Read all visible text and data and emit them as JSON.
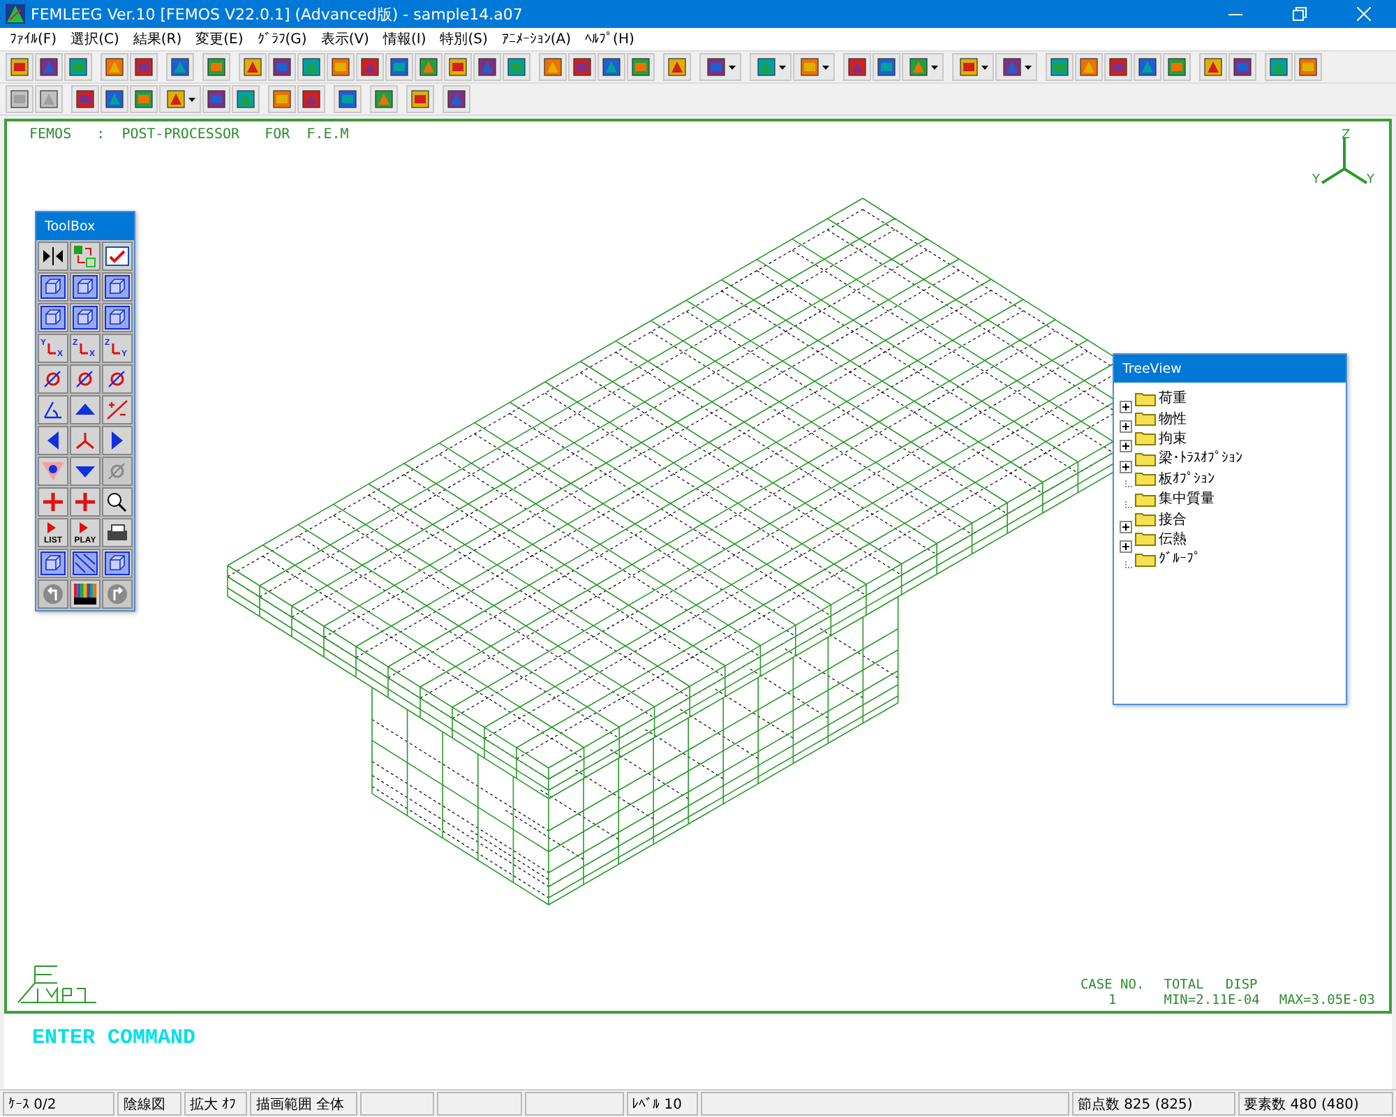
{
  "window": {
    "title": "FEMLEEG Ver.10 [FEMOS V22.0.1] (Advanced版) - sample14.a07"
  },
  "menu": [
    "ﾌｧｲﾙ(F)",
    "選択(C)",
    "結果(R)",
    "変更(E)",
    "ｸﾞﾗﾌ(G)",
    "表示(V)",
    "情報(I)",
    "特別(S)",
    "ｱﾆﾒｰｼｮﾝ(A)",
    "ﾍﾙﾌﾟ(H)"
  ],
  "canvas": {
    "header": "FEMOS   :  POST-PROCESSOR   FOR  F.E.M",
    "axes": [
      "Z",
      "Y",
      "Y"
    ],
    "result": {
      "case_label": "CASE NO.",
      "case_value": "1",
      "total_label": "TOTAL",
      "disp_label": "DISP",
      "min": "MIN=2.11E-04",
      "max": "MAX=3.05E-03"
    }
  },
  "toolbox": {
    "title": "ToolBox",
    "tools": [
      {
        "kind": "mirror",
        "disabled": false
      },
      {
        "kind": "swap",
        "disabled": false
      },
      {
        "kind": "check",
        "disabled": false
      },
      {
        "kind": "cube",
        "disabled": false
      },
      {
        "kind": "cube",
        "disabled": false
      },
      {
        "kind": "cube",
        "disabled": false
      },
      {
        "kind": "cube",
        "disabled": false
      },
      {
        "kind": "cube",
        "disabled": false
      },
      {
        "kind": "cube",
        "disabled": false
      },
      {
        "kind": "axis",
        "text": "Y",
        "text2": "X",
        "disabled": false
      },
      {
        "kind": "axis",
        "text": "Z",
        "text2": "X",
        "disabled": false
      },
      {
        "kind": "axis",
        "text": "Z",
        "text2": "Y",
        "disabled": false
      },
      {
        "kind": "rotate",
        "disabled": false
      },
      {
        "kind": "rotate",
        "disabled": false
      },
      {
        "kind": "rotate",
        "disabled": false
      },
      {
        "kind": "angle",
        "disabled": false
      },
      {
        "kind": "up",
        "disabled": false
      },
      {
        "kind": "plusminus",
        "disabled": false
      },
      {
        "kind": "left",
        "disabled": false
      },
      {
        "kind": "triad",
        "disabled": false
      },
      {
        "kind": "right",
        "disabled": false
      },
      {
        "kind": "eye",
        "disabled": false
      },
      {
        "kind": "down",
        "disabled": false
      },
      {
        "kind": "rotate",
        "disabled": true
      },
      {
        "kind": "move",
        "disabled": false
      },
      {
        "kind": "move",
        "disabled": false
      },
      {
        "kind": "zoom",
        "disabled": false
      },
      {
        "kind": "label",
        "text": "LIST",
        "disabled": false
      },
      {
        "kind": "label",
        "text": "PLAY",
        "disabled": false
      },
      {
        "kind": "printer",
        "disabled": false
      },
      {
        "kind": "cube",
        "disabled": false
      },
      {
        "kind": "hatch",
        "disabled": false
      },
      {
        "kind": "cube",
        "disabled": false
      },
      {
        "kind": "undo",
        "disabled": true
      },
      {
        "kind": "colors",
        "disabled": false
      },
      {
        "kind": "redo",
        "disabled": true
      }
    ]
  },
  "tree": {
    "title": "TreeView",
    "items": [
      {
        "label": "荷重",
        "has_children": true
      },
      {
        "label": "物性",
        "has_children": true
      },
      {
        "label": "拘束",
        "has_children": true
      },
      {
        "label": "梁･ﾄﾗｽｵﾌﾟｼｮﾝ",
        "has_children": true
      },
      {
        "label": "板ｵﾌﾟｼｮﾝ",
        "has_children": false
      },
      {
        "label": "集中質量",
        "has_children": false
      },
      {
        "label": "接合",
        "has_children": true
      },
      {
        "label": "伝熱",
        "has_children": true
      },
      {
        "label": "ｸﾞﾙｰﾌﾟ",
        "has_children": false
      }
    ]
  },
  "command": {
    "prompt": "ENTER COMMAND"
  },
  "status_bar": [
    {
      "kind": "text",
      "text": "ｹｰｽ 0/2"
    },
    {
      "kind": "text",
      "text": "陰線図"
    },
    {
      "kind": "text",
      "text": "拡大 ｵﾌ"
    },
    {
      "kind": "text",
      "text": "描画範囲 全体"
    },
    {
      "kind": "blank"
    },
    {
      "kind": "blank"
    },
    {
      "kind": "blank"
    },
    {
      "kind": "text",
      "text": "ﾚﾍﾞﾙ 10"
    },
    {
      "kind": "blank"
    },
    {
      "kind": "text",
      "text": "節点数 825 (825)"
    },
    {
      "kind": "text",
      "text": "要素数 480 (480)"
    }
  ]
}
